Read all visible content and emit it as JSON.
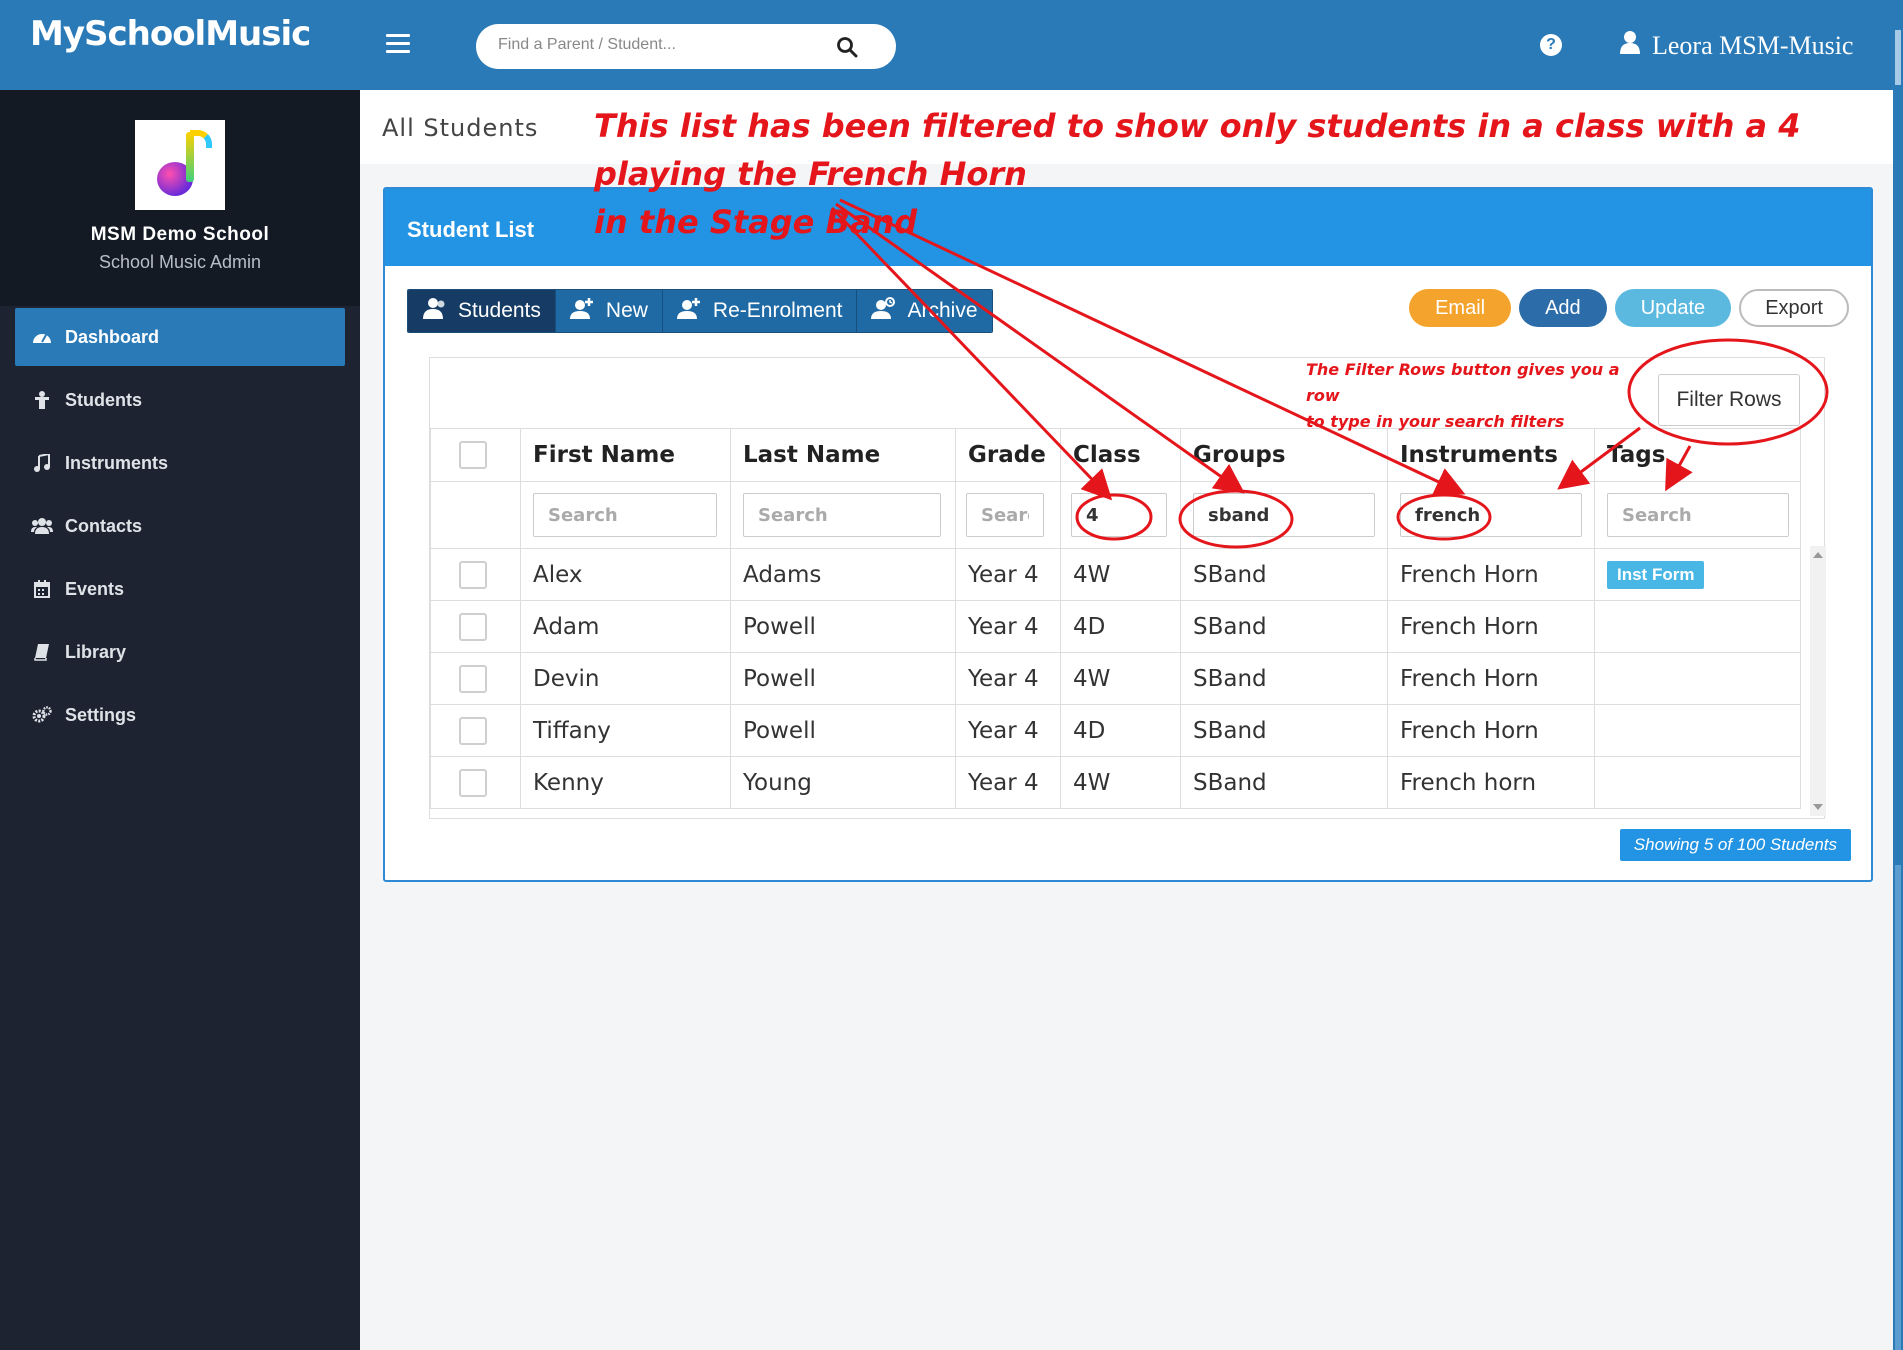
{
  "header": {
    "logo_text": "MySchoolMusic",
    "search_placeholder": "Find a Parent / Student...",
    "user_name": "Leora MSM-Music"
  },
  "sidebar": {
    "school_name": "MSM Demo School",
    "school_role": "School Music Admin",
    "items": [
      {
        "label": "Dashboard",
        "icon": "dashboard-icon",
        "active": true
      },
      {
        "label": "Students",
        "icon": "student-icon"
      },
      {
        "label": "Instruments",
        "icon": "music-note-icon"
      },
      {
        "label": "Contacts",
        "icon": "contacts-icon"
      },
      {
        "label": "Events",
        "icon": "calendar-icon"
      },
      {
        "label": "Library",
        "icon": "book-icon"
      },
      {
        "label": "Settings",
        "icon": "gears-icon"
      }
    ]
  },
  "page": {
    "title": "All Students"
  },
  "panel": {
    "title": "Student List",
    "tabs": [
      "Students",
      "New",
      "Re-Enrolment",
      "Archive"
    ],
    "buttons": {
      "email": "Email",
      "add": "Add",
      "update": "Update",
      "export": "Export"
    },
    "filter_rows_label": "Filter Rows",
    "columns": [
      "First Name",
      "Last Name",
      "Grade",
      "Class",
      "Groups",
      "Instruments",
      "Tags"
    ],
    "filters": {
      "first_name": "",
      "last_name": "",
      "grade": "",
      "class": "4",
      "groups": "sband",
      "instruments": "french",
      "tags": ""
    },
    "filter_placeholder": "Search",
    "grade_placeholder": "Searc",
    "rows": [
      {
        "first": "Alex",
        "last": "Adams",
        "grade": "Year 4",
        "class": "4W",
        "groups": "SBand",
        "instrument": "French Horn",
        "tag": "Inst Form"
      },
      {
        "first": "Adam",
        "last": "Powell",
        "grade": "Year 4",
        "class": "4D",
        "groups": "SBand",
        "instrument": "French Horn",
        "tag": ""
      },
      {
        "first": "Devin",
        "last": "Powell",
        "grade": "Year 4",
        "class": "4W",
        "groups": "SBand",
        "instrument": "French Horn",
        "tag": ""
      },
      {
        "first": "Tiffany",
        "last": "Powell",
        "grade": "Year 4",
        "class": "4D",
        "groups": "SBand",
        "instrument": "French Horn",
        "tag": ""
      },
      {
        "first": "Kenny",
        "last": "Young",
        "grade": "Year 4",
        "class": "4W",
        "groups": "SBand",
        "instrument": "French horn",
        "tag": ""
      }
    ],
    "showing_text": "Showing 5 of 100 Students"
  },
  "annotations": {
    "main_line1": "This list has been filtered to show only students in a class with a 4 playing the French Horn",
    "main_line2": "in the Stage Band",
    "filter_note_line1": "The Filter Rows button gives you a row",
    "filter_note_line2": "to type in your search filters",
    "color": "#e4161b"
  },
  "colors": {
    "topbar": "#2a7ab7",
    "sidebar": "#1d2330",
    "panel_header": "#2393e3",
    "email": "#f4a32c",
    "add": "#2c6ca9",
    "update": "#5bb9e0"
  }
}
